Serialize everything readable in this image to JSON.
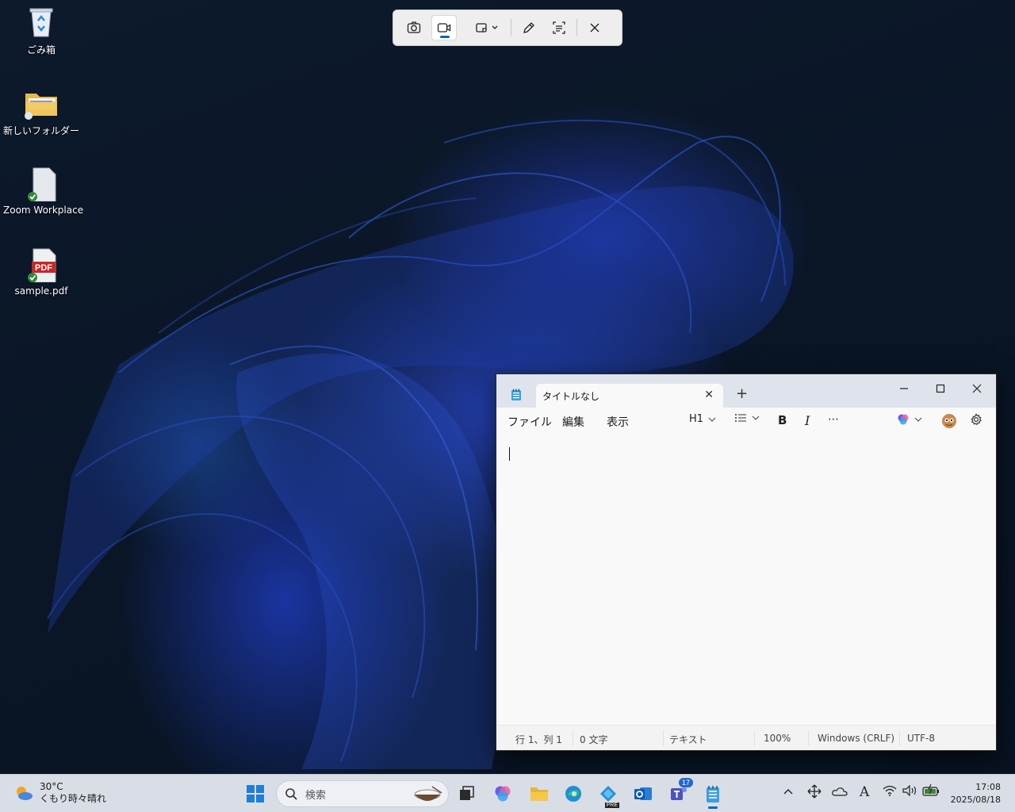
{
  "desktop": {
    "icons": [
      {
        "label": "ごみ箱"
      },
      {
        "label": "新しいフォルダー"
      },
      {
        "label": "Zoom Workplace"
      },
      {
        "label": "sample.pdf",
        "badge": "PDF"
      }
    ]
  },
  "snipping_toolbar": {
    "tools": [
      "camera-icon",
      "video-icon",
      "snip-mode-icon",
      "pen-icon",
      "text-actions-icon",
      "close-icon"
    ],
    "active": "video-icon"
  },
  "notepad": {
    "tab_title": "タイトルなし",
    "menu": {
      "file": "ファイル",
      "edit": "編集",
      "view": "表示"
    },
    "toolbar": {
      "heading": "H1"
    },
    "status": {
      "position": "行 1、列 1",
      "chars": "0 文字",
      "format": "テキスト",
      "zoom": "100%",
      "line_ending": "Windows (CRLF)",
      "encoding": "UTF-8"
    }
  },
  "taskbar": {
    "weather": {
      "temp": "30°C",
      "desc": "くもり時々晴れ"
    },
    "search_placeholder": "検索",
    "teams_badge": "17",
    "clock": {
      "time": "17:08",
      "date": "2025/08/18"
    },
    "edge_pre": "PRE"
  },
  "colors": {
    "accent": "#0067c0",
    "taskbar": "#d9dde6"
  }
}
